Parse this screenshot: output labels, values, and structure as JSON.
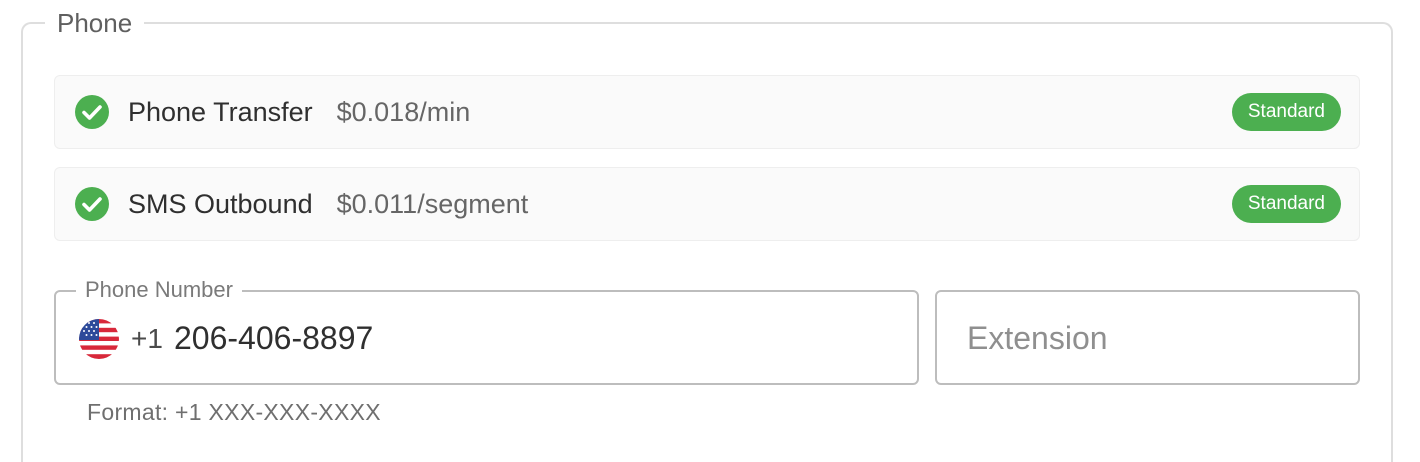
{
  "section": {
    "legend": "Phone"
  },
  "services": [
    {
      "name": "Phone Transfer",
      "price": "$0.018/min",
      "badge": "Standard",
      "icon": "check-circle-icon"
    },
    {
      "name": "SMS Outbound",
      "price": "$0.011/segment",
      "badge": "Standard",
      "icon": "check-circle-icon"
    }
  ],
  "phone_field": {
    "label": "Phone Number",
    "country_flag": "us-flag-icon",
    "dial_code": "+1",
    "value": "206-406-8897",
    "helper": "Format: +1 XXX-XXX-XXXX"
  },
  "extension_field": {
    "value": "",
    "placeholder": "Extension"
  },
  "colors": {
    "success": "#4caf50",
    "border": "#bdbdbd",
    "row_bg": "#fafafa"
  }
}
